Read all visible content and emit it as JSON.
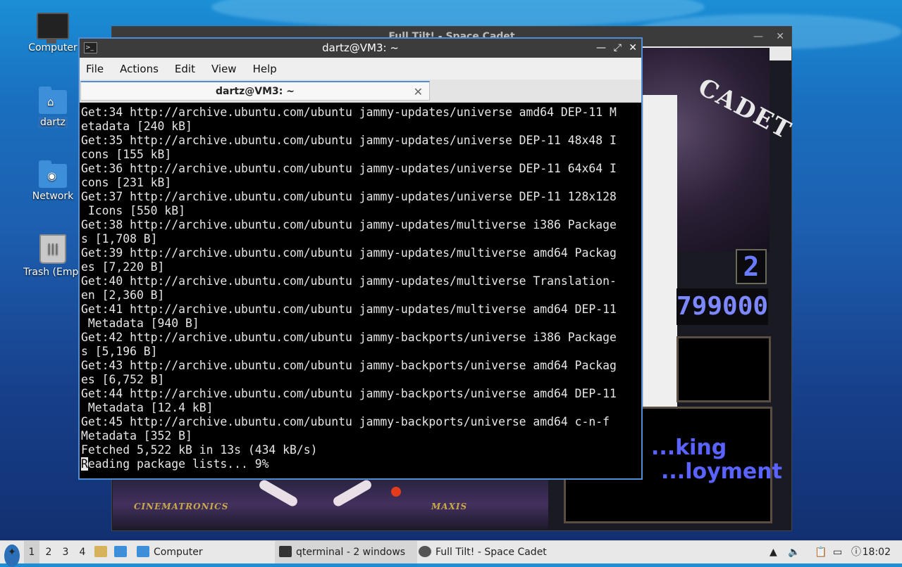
{
  "desktop": {
    "icons": [
      {
        "label": "Computer"
      },
      {
        "label": "dartz"
      },
      {
        "label": "Network"
      },
      {
        "label": "Trash (Empt"
      }
    ]
  },
  "pinball_window": {
    "title": "Full Tilt! - Space Cadet",
    "art_title": "CADET",
    "ball_number": "2",
    "score": "799000",
    "mission_text_line1": "...king",
    "mission_text_line2": "...loyment",
    "brand_left": "CINEMATRONICS",
    "brand_right": "MAXIS"
  },
  "terminal": {
    "title": "dartz@VM3: ~",
    "menu": [
      "File",
      "Actions",
      "Edit",
      "View",
      "Help"
    ],
    "tab_label": "dartz@VM3: ~",
    "lines": [
      "Get:34 http://archive.ubuntu.com/ubuntu jammy-updates/universe amd64 DEP-11 M",
      "etadata [240 kB]",
      "Get:35 http://archive.ubuntu.com/ubuntu jammy-updates/universe DEP-11 48x48 I",
      "cons [155 kB]",
      "Get:36 http://archive.ubuntu.com/ubuntu jammy-updates/universe DEP-11 64x64 I",
      "cons [231 kB]",
      "Get:37 http://archive.ubuntu.com/ubuntu jammy-updates/universe DEP-11 128x128",
      " Icons [550 kB]",
      "Get:38 http://archive.ubuntu.com/ubuntu jammy-updates/multiverse i386 Package",
      "s [1,708 B]",
      "Get:39 http://archive.ubuntu.com/ubuntu jammy-updates/multiverse amd64 Packag",
      "es [7,220 B]",
      "Get:40 http://archive.ubuntu.com/ubuntu jammy-updates/multiverse Translation-",
      "en [2,360 B]",
      "Get:41 http://archive.ubuntu.com/ubuntu jammy-updates/multiverse amd64 DEP-11",
      " Metadata [940 B]",
      "Get:42 http://archive.ubuntu.com/ubuntu jammy-backports/universe i386 Package",
      "s [5,196 B]",
      "Get:43 http://archive.ubuntu.com/ubuntu jammy-backports/universe amd64 Packag",
      "es [6,752 B]",
      "Get:44 http://archive.ubuntu.com/ubuntu jammy-backports/universe amd64 DEP-11",
      " Metadata [12.4 kB]",
      "Get:45 http://archive.ubuntu.com/ubuntu jammy-backports/universe amd64 c-n-f",
      "Metadata [352 B]",
      "Fetched 5,522 kB in 13s (434 kB/s)"
    ],
    "cursor_char": "R",
    "last_line_rest": "eading package lists... 9%"
  },
  "taskbar": {
    "workspaces": [
      "1",
      "2",
      "3",
      "4"
    ],
    "file_manager_label": "Computer",
    "tasks": [
      {
        "label": "qterminal - 2 windows",
        "icon": "terminal-icon"
      },
      {
        "label": "Full Tilt! - Space Cadet",
        "icon": "pinball-icon"
      }
    ],
    "clock": "18:02"
  }
}
